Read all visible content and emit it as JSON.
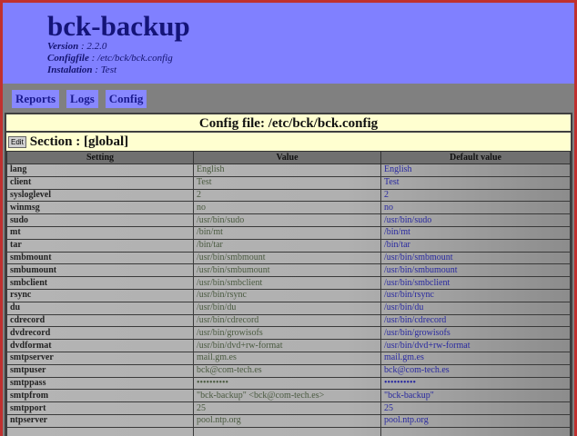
{
  "header": {
    "title": "bck-backup",
    "version_label": "Version",
    "version": "2.2.0",
    "configfile_label": "Configfile",
    "configfile": "/etc/bck/bck.config",
    "instalation_label": "Instalation",
    "instalation": "Test"
  },
  "nav": [
    "Reports",
    "Logs",
    "Config"
  ],
  "panel": {
    "title": "Config file: /etc/bck/bck.config",
    "edit_label": "Edit",
    "section": "Section : [global]"
  },
  "table": {
    "columns": [
      "Setting",
      "Value",
      "Default value"
    ],
    "rows": [
      [
        "lang",
        "English",
        "English"
      ],
      [
        "client",
        "Test",
        "Test"
      ],
      [
        "sysloglevel",
        "2",
        "2"
      ],
      [
        "winmsg",
        "no",
        "no"
      ],
      [
        "sudo",
        "/usr/bin/sudo",
        "/usr/bin/sudo"
      ],
      [
        "mt",
        "/bin/mt",
        "/bin/mt"
      ],
      [
        "tar",
        "/bin/tar",
        "/bin/tar"
      ],
      [
        "smbmount",
        "/usr/bin/smbmount",
        "/usr/bin/smbmount"
      ],
      [
        "smbumount",
        "/usr/bin/smbumount",
        "/usr/bin/smbumount"
      ],
      [
        "smbclient",
        "/usr/bin/smbclient",
        "/usr/bin/smbclient"
      ],
      [
        "rsync",
        "/usr/bin/rsync",
        "/usr/bin/rsync"
      ],
      [
        "du",
        "/usr/bin/du",
        "/usr/bin/du"
      ],
      [
        "cdrecord",
        "/usr/bin/cdrecord",
        "/usr/bin/cdrecord"
      ],
      [
        "dvdrecord",
        "/usr/bin/growisofs",
        "/usr/bin/growisofs"
      ],
      [
        "dvdformat",
        "/usr/bin/dvd+rw-format",
        "/usr/bin/dvd+rw-format"
      ],
      [
        "smtpserver",
        "mail.gm.es",
        "mail.gm.es"
      ],
      [
        "smtpuser",
        "bck@com-tech.es",
        "bck@com-tech.es"
      ],
      [
        "smtppass",
        "••••••••••",
        "••••••••••"
      ],
      [
        "smtpfrom",
        "\"bck-backup\" <bck@com-tech.es>",
        "\"bck-backup\""
      ],
      [
        "smtpport",
        "25",
        "25"
      ],
      [
        "ntpserver",
        "pool.ntp.org",
        "pool.ntp.org"
      ]
    ]
  }
}
